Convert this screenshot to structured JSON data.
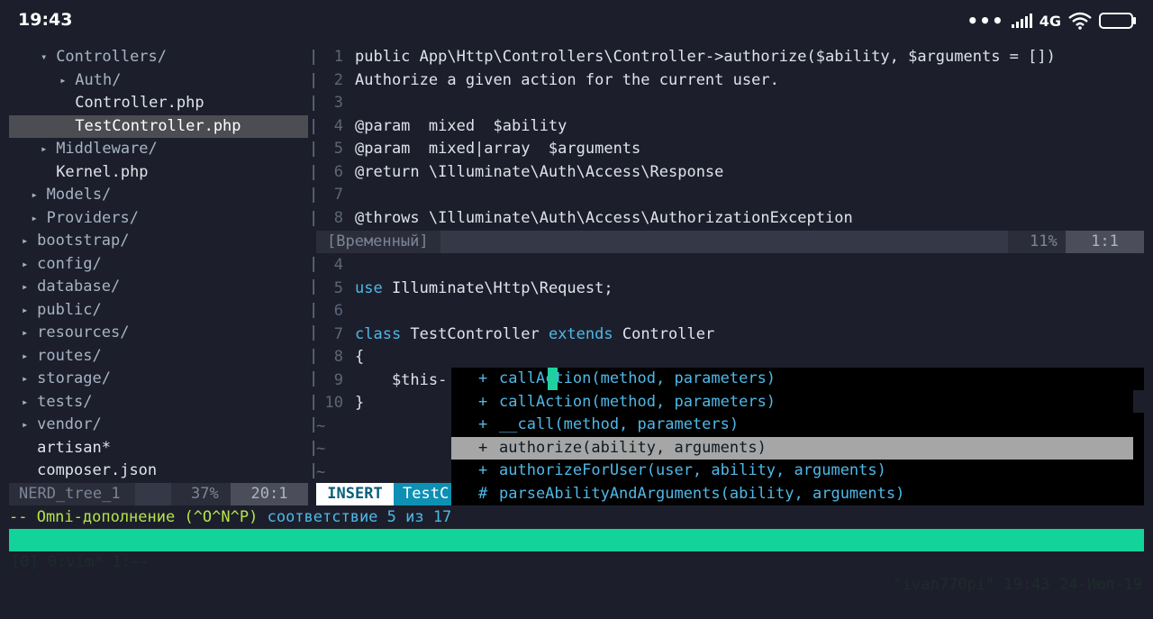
{
  "statusbar": {
    "time": "19:43",
    "network": "4G",
    "icons": [
      "more-dots-icon",
      "signal-icon",
      "wifi-icon",
      "battery-icon"
    ]
  },
  "tree": {
    "rows": [
      {
        "text": "Controllers/",
        "type": "dir-open",
        "indent": 4
      },
      {
        "text": "Auth/",
        "type": "dir",
        "indent": 6
      },
      {
        "text": "Controller.php",
        "type": "file",
        "indent": 6
      },
      {
        "text": "TestController.php",
        "type": "file",
        "indent": 6,
        "selected": true
      },
      {
        "text": "Middleware/",
        "type": "dir",
        "indent": 4
      },
      {
        "text": "Kernel.php",
        "type": "file",
        "indent": 4
      },
      {
        "text": "Models/",
        "type": "dir",
        "indent": 3
      },
      {
        "text": "Providers/",
        "type": "dir",
        "indent": 3
      },
      {
        "text": "bootstrap/",
        "type": "dir",
        "indent": 2
      },
      {
        "text": "config/",
        "type": "dir",
        "indent": 2
      },
      {
        "text": "database/",
        "type": "dir",
        "indent": 2
      },
      {
        "text": "public/",
        "type": "dir",
        "indent": 2
      },
      {
        "text": "resources/",
        "type": "dir",
        "indent": 2
      },
      {
        "text": "routes/",
        "type": "dir",
        "indent": 2
      },
      {
        "text": "storage/",
        "type": "dir",
        "indent": 2
      },
      {
        "text": "tests/",
        "type": "dir",
        "indent": 2
      },
      {
        "text": "vendor/",
        "type": "dir",
        "indent": 2
      },
      {
        "text": "artisan*",
        "type": "file",
        "indent": 2
      },
      {
        "text": "composer.json",
        "type": "file",
        "indent": 2
      }
    ],
    "status": {
      "name": "NERD_tree_1",
      "percent": "37%",
      "position": "20:1"
    }
  },
  "preview": {
    "lines": [
      {
        "num": "1",
        "text": "public App\\Http\\Controllers\\Controller->authorize($ability, $arguments = [])"
      },
      {
        "num": "2",
        "text": "Authorize a given action for the current user."
      },
      {
        "num": "3",
        "text": ""
      },
      {
        "num": "4",
        "text": "@param  mixed  $ability"
      },
      {
        "num": "5",
        "text": "@param  mixed|array  $arguments"
      },
      {
        "num": "6",
        "text": "@return \\Illuminate\\Auth\\Access\\Response"
      },
      {
        "num": "7",
        "text": ""
      },
      {
        "num": "8",
        "text": "@throws \\Illuminate\\Auth\\Access\\AuthorizationException"
      }
    ],
    "status": {
      "name": "[Временный]",
      "percent": "11%",
      "position": "1:1"
    }
  },
  "editor": {
    "lines": [
      {
        "num": "4",
        "parts": []
      },
      {
        "num": "5",
        "parts": [
          {
            "t": "use",
            "kw": true
          },
          {
            "t": " Illuminate\\Http\\Request;"
          }
        ]
      },
      {
        "num": "6",
        "parts": []
      },
      {
        "num": "7",
        "parts": [
          {
            "t": "class",
            "kw": true
          },
          {
            "t": " TestController "
          },
          {
            "t": "extends",
            "kw": true
          },
          {
            "t": " Controller"
          }
        ]
      },
      {
        "num": "8",
        "parts": [
          {
            "t": "{"
          }
        ]
      },
      {
        "num": "9",
        "parts": [
          {
            "t": "    $this-"
          }
        ]
      },
      {
        "num": "10",
        "parts": [
          {
            "t": "}"
          }
        ]
      }
    ],
    "tildes": [
      "~",
      "~",
      "~"
    ],
    "mode": "INSERT",
    "filename": "TestC"
  },
  "completion": {
    "items": [
      {
        "kind": "+",
        "text": "callAction(method, parameters)"
      },
      {
        "kind": "+",
        "text": "callAction(method, parameters)"
      },
      {
        "kind": "+",
        "text": "__call(method, parameters)"
      },
      {
        "kind": "+",
        "text": "authorize(ability, arguments)",
        "selected": true
      },
      {
        "kind": "+",
        "text": "authorizeForUser(user, ability, arguments)"
      },
      {
        "kind": "#",
        "text": "parseAbilityAndArguments(ability, arguments)"
      }
    ]
  },
  "cmdline": {
    "message": "-- Omni-дополнение (^O^N^P)",
    "match": "соответствие 5 из 17"
  },
  "tmux": {
    "left": "[0] 0:vim* 1:~-",
    "right": "\"ivan770pi\" 19:43 24-Июл-19"
  },
  "colors": {
    "background": "#1c1f2b",
    "keyword": "#4fb8e8",
    "tmux_bar": "#12d39a",
    "omni_message": "#b6e34a",
    "mode_fg": "#0a5f7a",
    "filename_bg": "#0d90b4"
  }
}
